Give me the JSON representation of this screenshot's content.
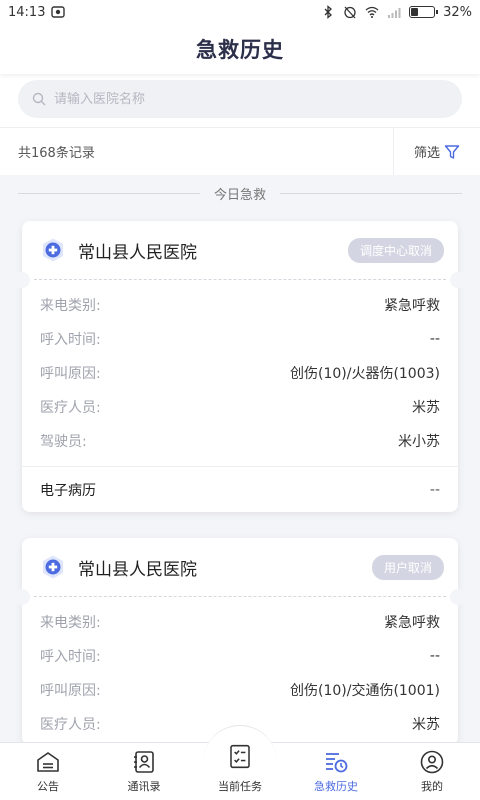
{
  "status_bar": {
    "time": "14:13",
    "battery": "32%",
    "battery_level": 0.32
  },
  "header": {
    "title": "急救历史"
  },
  "search": {
    "placeholder": "请输入医院名称"
  },
  "filter_bar": {
    "count": "共168条记录",
    "filter_label": "筛选"
  },
  "section": {
    "label": "今日急救"
  },
  "cards": [
    {
      "hospital": "常山县人民医院",
      "status": "调度中心取消",
      "rows": [
        {
          "label": "来电类别:",
          "value": "紧急呼救"
        },
        {
          "label": "呼入时间:",
          "value": "--"
        },
        {
          "label": "呼叫原因:",
          "value": "创伤(10)/火器伤(1003)"
        },
        {
          "label": "医疗人员:",
          "value": "米苏"
        },
        {
          "label": "驾驶员:",
          "value": "米小苏"
        }
      ],
      "footer": {
        "label": "电子病历",
        "value": "--"
      }
    },
    {
      "hospital": "常山县人民医院",
      "status": "用户取消",
      "rows": [
        {
          "label": "来电类别:",
          "value": "紧急呼救"
        },
        {
          "label": "呼入时间:",
          "value": "--"
        },
        {
          "label": "呼叫原因:",
          "value": "创伤(10)/交通伤(1001)"
        },
        {
          "label": "医疗人员:",
          "value": "米苏"
        }
      ]
    }
  ],
  "tabs": [
    {
      "label": "公告",
      "icon": "announcement-icon"
    },
    {
      "label": "通讯录",
      "icon": "contacts-icon"
    },
    {
      "label": "当前任务",
      "icon": "task-list-icon"
    },
    {
      "label": "急救历史",
      "icon": "history-icon",
      "active": true
    },
    {
      "label": "我的",
      "icon": "profile-icon"
    }
  ],
  "colors": {
    "accent": "#4d6be0",
    "badge": "#d3d6e2",
    "title": "#2b2f4a"
  }
}
